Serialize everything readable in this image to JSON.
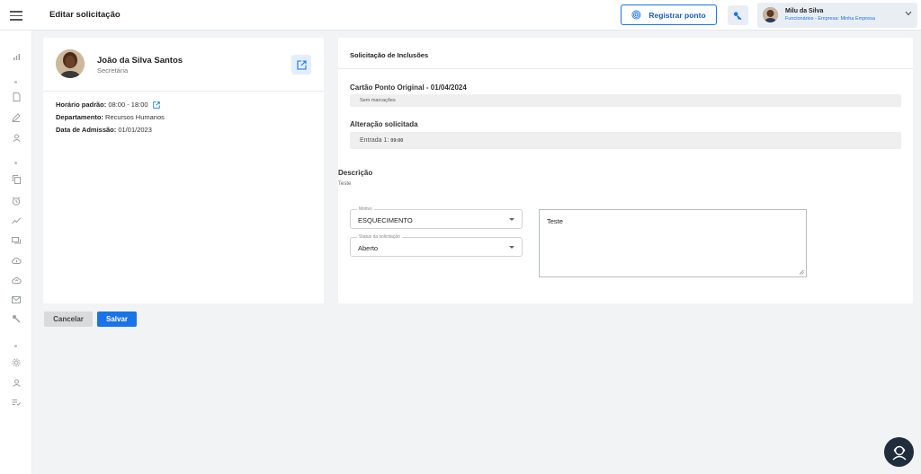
{
  "header": {
    "title": "Editar solicitação",
    "register_button_label": "Registrar ponto",
    "user": {
      "name": "Milu da Silva",
      "subtitle": "Funcionários - Empresa: Minha Empresa"
    }
  },
  "sidebar": {
    "icons": [
      "chart-icon",
      "document-icon",
      "pen-icon",
      "person-icon",
      "copy-icon",
      "alarm-icon",
      "trend-icon",
      "chat-icon",
      "cloud-icon",
      "cloud-upload-icon",
      "mail-icon",
      "key-icon",
      "gear-icon",
      "user-icon",
      "checklist-icon"
    ]
  },
  "employee": {
    "name": "João da Silva Santos",
    "role": "Secretária",
    "schedule_label": "Horário padrão:",
    "schedule_value": "08:00 - 18:00",
    "department_label": "Departamento:",
    "department_value": "Recursos Humanos",
    "admission_label": "Data de Admissão:",
    "admission_value": "01/01/2023"
  },
  "request": {
    "title": "Solicitação de Inclusões",
    "original_label": "Cartão Ponto Original - 01/04/2024",
    "original_value": "Sem marcações",
    "change_label": "Alteração solicitada",
    "change_prefix": "Entrada 1:",
    "change_time": "09:00",
    "description_label": "Descrição",
    "description_value": "Teste",
    "reason_legend": "Motivo",
    "reason_value": "ESQUECIMENTO",
    "status_legend": "Status da solicitação",
    "status_value": "Aberto",
    "comment_value": "Teste"
  },
  "actions": {
    "cancel_label": "Cancelar",
    "save_label": "Salvar"
  },
  "colors": {
    "primary": "#1a73e8",
    "fab": "#1f2d3d"
  }
}
